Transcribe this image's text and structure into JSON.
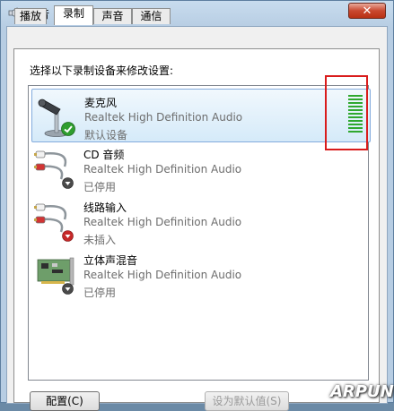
{
  "window": {
    "title": "声音",
    "close_label": "✕"
  },
  "tabs": [
    {
      "label": "播放",
      "active": false
    },
    {
      "label": "录制",
      "active": true
    },
    {
      "label": "声音",
      "active": false
    },
    {
      "label": "通信",
      "active": false
    }
  ],
  "panel": {
    "prompt": "选择以下录制设备来修改设置:"
  },
  "devices": [
    {
      "name": "麦克风",
      "driver": "Realtek High Definition Audio",
      "status": "默认设备",
      "icon": "microphone-icon",
      "badge": "default-check-icon",
      "selected": true
    },
    {
      "name": "CD 音频",
      "driver": "Realtek High Definition Audio",
      "status": "已停用",
      "icon": "rca-cable-icon",
      "badge": "disabled-arrow-icon",
      "selected": false
    },
    {
      "name": "线路输入",
      "driver": "Realtek High Definition Audio",
      "status": "未插入",
      "icon": "rca-cable-icon",
      "badge": "unplugged-icon",
      "selected": false
    },
    {
      "name": "立体声混音",
      "driver": "Realtek High Definition Audio",
      "status": "已停用",
      "icon": "sound-card-icon",
      "badge": "disabled-arrow-icon",
      "selected": false
    }
  ],
  "level_meter": {
    "color": "#2fa82f",
    "segments_lit": 11
  },
  "buttons": {
    "configure": "配置(C)",
    "set_default": "设为默认值(S)"
  },
  "watermark": "ARPUN",
  "colors": {
    "accent": "#d91c1c",
    "meter": "#2fa82f",
    "selection": "#84acdd"
  }
}
